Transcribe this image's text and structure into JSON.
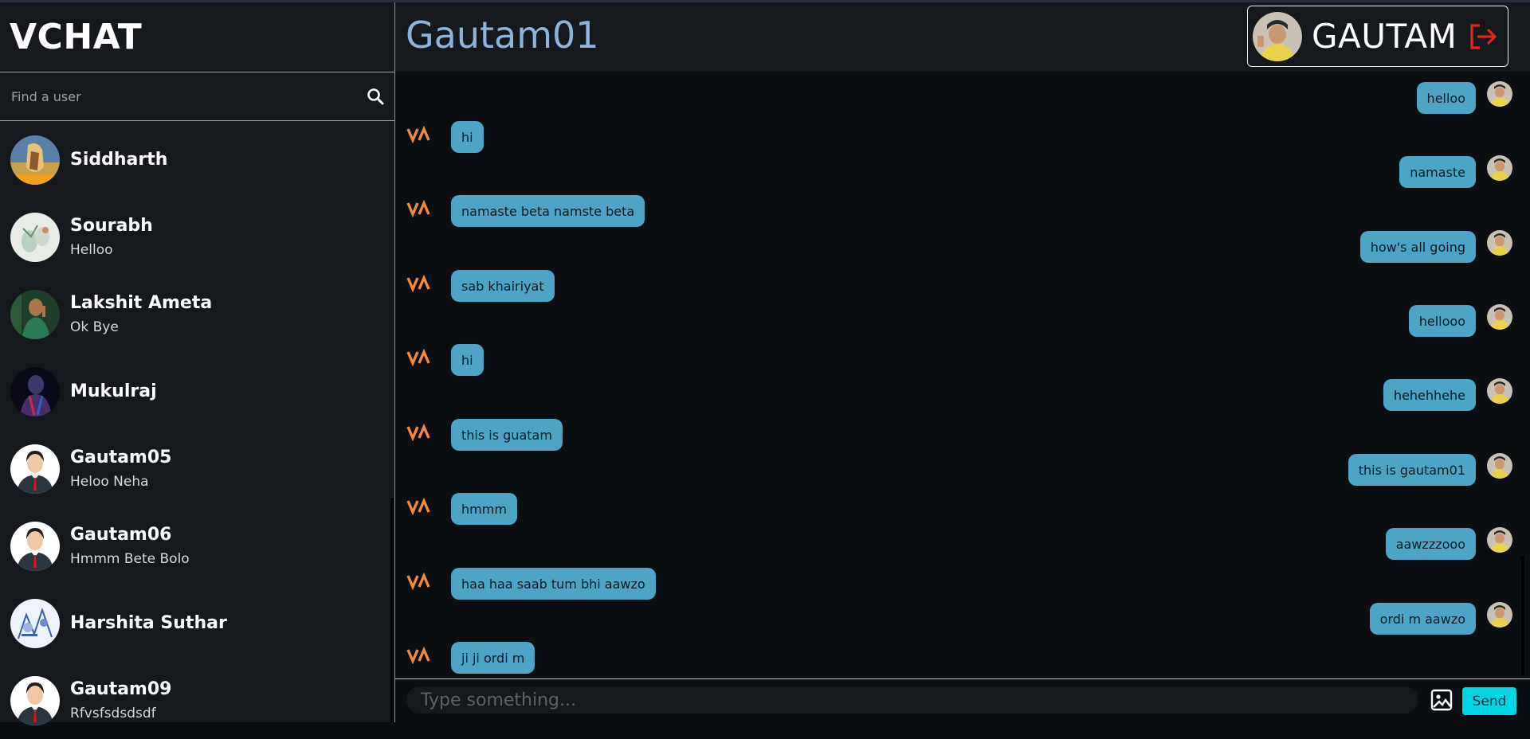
{
  "app": {
    "brand": "VCHAT"
  },
  "search": {
    "placeholder": "Find a user"
  },
  "users": [
    {
      "name": "Siddharth",
      "last_message": ""
    },
    {
      "name": "Sourabh",
      "last_message": "Helloo"
    },
    {
      "name": "Lakshit Ameta",
      "last_message": "Ok Bye"
    },
    {
      "name": "Mukulraj",
      "last_message": ""
    },
    {
      "name": "Gautam05",
      "last_message": "Heloo Neha"
    },
    {
      "name": "Gautam06",
      "last_message": "Hmmm Bete Bolo"
    },
    {
      "name": "Harshita Suthar",
      "last_message": ""
    },
    {
      "name": "Gautam09",
      "last_message": "Rfvsfsdsdsdf"
    }
  ],
  "chat": {
    "title": "Gautam01",
    "current_user": "GAUTAM",
    "messages": [
      {
        "from": "me",
        "text": "helloo"
      },
      {
        "from": "them",
        "text": "hi"
      },
      {
        "from": "me",
        "text": "namaste"
      },
      {
        "from": "them",
        "text": "namaste beta namste beta"
      },
      {
        "from": "me",
        "text": "how's all going"
      },
      {
        "from": "them",
        "text": "sab khairiyat"
      },
      {
        "from": "me",
        "text": "hellooo"
      },
      {
        "from": "them",
        "text": "hi"
      },
      {
        "from": "me",
        "text": "hehehhehe"
      },
      {
        "from": "them",
        "text": "this is guatam"
      },
      {
        "from": "me",
        "text": "this is gautam01"
      },
      {
        "from": "them",
        "text": "hmmm"
      },
      {
        "from": "me",
        "text": "aawzzzooo"
      },
      {
        "from": "them",
        "text": "haa haa saab tum bhi aawzo"
      },
      {
        "from": "me",
        "text": "ordi m aawzo"
      },
      {
        "from": "them",
        "text": "ji ji ordi m"
      }
    ]
  },
  "composer": {
    "placeholder": "Type something...",
    "send_label": "Send"
  },
  "colors": {
    "bubble": "#4da4c4",
    "send": "#00d5e6",
    "title": "#8fb3d9",
    "logout": "#e0271f",
    "logo": "#f08a3c"
  },
  "icons": {
    "search": "search-icon",
    "logout": "logout-icon",
    "image": "image-icon",
    "contact_logo": "va-logo-icon"
  }
}
